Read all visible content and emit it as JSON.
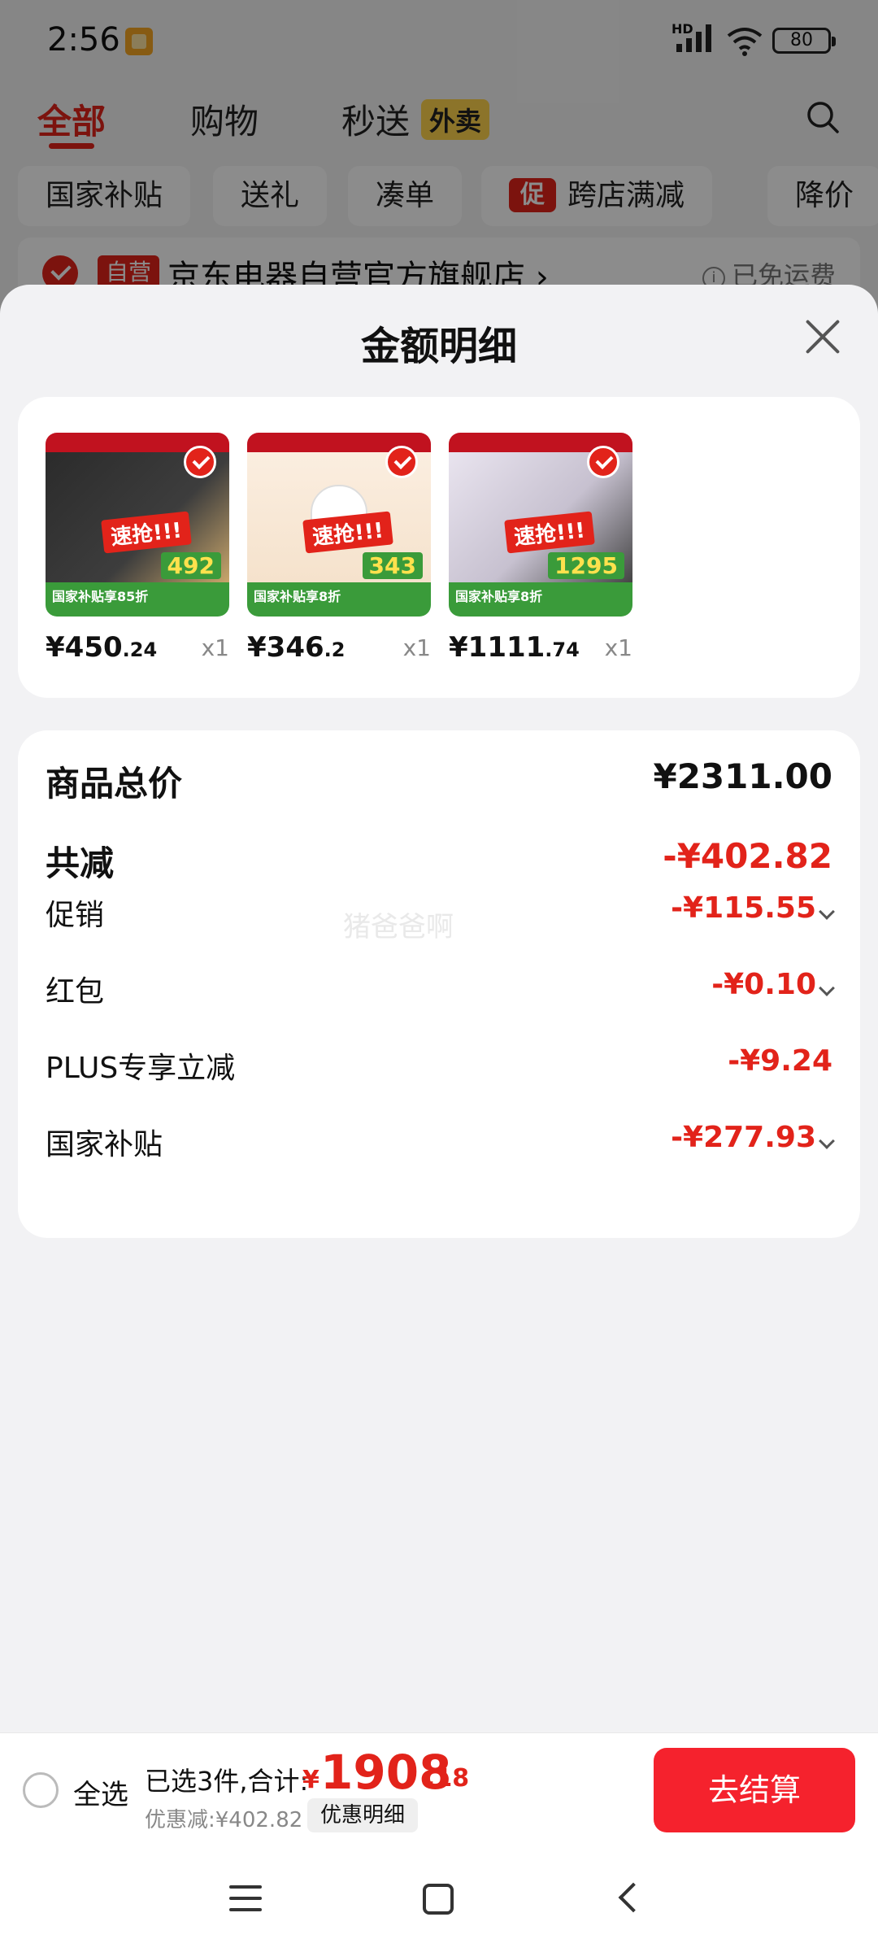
{
  "status_bar": {
    "time": "2:56",
    "network": "HD",
    "battery": "80"
  },
  "top_tabs": [
    {
      "label": "全部",
      "active": true
    },
    {
      "label": "购物",
      "active": false
    },
    {
      "label": "秒送",
      "badge": "外卖",
      "active": false
    }
  ],
  "filter_chips": [
    "国家补贴",
    "送礼",
    "凑单",
    "跨店满减",
    "降价"
  ],
  "promo_tag": "促",
  "store": {
    "tag": "自营",
    "name": "京东电器自营官方旗舰店 ›",
    "shipping": "已免运费"
  },
  "sheet": {
    "title": "金额明细"
  },
  "products": [
    {
      "price_int": "¥450",
      "price_dec": ".24",
      "qty": "x1",
      "thumb_price": "492",
      "thumb_banner": "速抢!!!",
      "thumb_bottom": "国家补贴享85折"
    },
    {
      "price_int": "¥346",
      "price_dec": ".2",
      "qty": "x1",
      "thumb_price": "343",
      "thumb_banner": "速抢!!!",
      "thumb_bottom": "国家补贴享8折"
    },
    {
      "price_int": "¥1111",
      "price_dec": ".74",
      "qty": "x1",
      "thumb_price": "1295",
      "thumb_banner": "速抢!!!",
      "thumb_bottom": "国家补贴享8折"
    }
  ],
  "details": {
    "total_label": "商品总价",
    "total_value": "¥2311.00",
    "reduce_label": "共减",
    "reduce_value": "-¥402.82",
    "items": [
      {
        "label": "促销",
        "value": "-¥115.55",
        "expandable": true
      },
      {
        "label": "红包",
        "value": "-¥0.10",
        "expandable": true
      },
      {
        "label": "PLUS专享立减",
        "value": "-¥9.24",
        "expandable": false
      },
      {
        "label": "国家补贴",
        "value": "-¥277.93",
        "expandable": true
      }
    ],
    "watermark": "猪爸爸啊"
  },
  "bottom_bar": {
    "select_all": "全选",
    "summary": "已选3件,合计:",
    "currency": "¥",
    "total_int": "1908",
    "total_dec": ".18",
    "discount": "优惠减:¥402.82",
    "detail_button": "优惠明细",
    "checkout_button": "去结算"
  },
  "colors": {
    "accent": "#e2231a",
    "checkout": "#f5222d",
    "sheet_bg": "#f2f2f4"
  }
}
